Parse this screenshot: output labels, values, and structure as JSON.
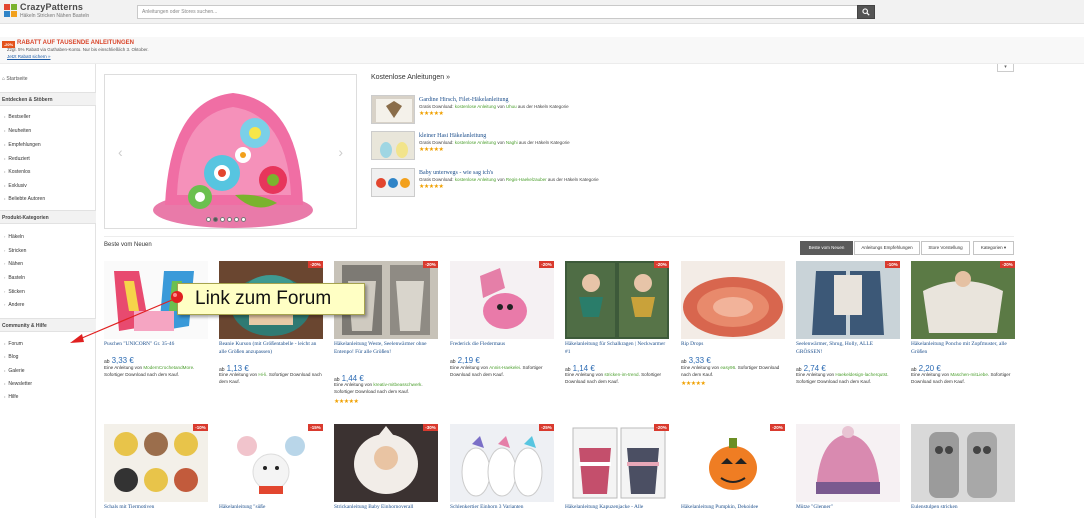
{
  "header": {
    "logo_name": "CrazyPatterns",
    "logo_tagline": "Häkeln Stricken Nähen Basteln",
    "search_placeholder": "Anleitungen oder Stores suchen...",
    "colors": {
      "red": "#e2462f",
      "green": "#7ab32e",
      "blue": "#2f84c7",
      "orange": "#f2a01c"
    }
  },
  "promo": {
    "badge": "-20%",
    "title": "RABATT AUF TAUSENDE ANLEITUNGEN",
    "subtitle": "Zzgl. 5% Rabatt via Guthaben-Konto. Nur bis einschließlich 3. Oktober.",
    "link": "Jetzt Rabatt sichern »"
  },
  "sidebar": {
    "home": "Startseite",
    "sections": [
      {
        "title": "Entdecken & Stöbern",
        "items": [
          "Bestseller",
          "Neuheiten",
          "Empfehlungen",
          "Reduziert",
          "Kostenlos",
          "Exklusiv",
          "Beliebte Autoren"
        ]
      },
      {
        "title": "Produkt-Kategorien",
        "items": [
          "Häkeln",
          "Stricken",
          "Nähen",
          "Basteln",
          "Sticken",
          "Andere"
        ]
      },
      {
        "title": "Community & Hilfe",
        "items": [
          "Forum",
          "Blog",
          "Galerie",
          "Newsletter",
          "Hilfe"
        ]
      }
    ]
  },
  "free": {
    "title": "Kostenlose Anleitungen »",
    "items": [
      {
        "name": "Gardine Hirsch, Filet-Häkelanleitung",
        "prefix": "Gratis Download:",
        "type": "kostenlose Anleitung",
        "by": "von",
        "author": "Uhuu",
        "suffix": "aus der Häkeln Kategorie",
        "stars": "★★★★★"
      },
      {
        "name": "kleiner Hasi Häkelanleitung",
        "prefix": "Gratis Download:",
        "type": "kostenlose Anleitung",
        "by": "von",
        "author": "Naghi",
        "suffix": "aus der Häkeln Kategorie",
        "stars": "★★★★★"
      },
      {
        "name": "Baby unterwegs - wie sag ich's",
        "prefix": "Gratis Download:",
        "type": "kostenlose Anleitung",
        "by": "von",
        "author": "Regis-Haekelzauber",
        "suffix": "aus der Häkeln Kategorie",
        "stars": "★★★★★"
      }
    ]
  },
  "best": {
    "title": "Beste vom Neuen",
    "tabs": [
      "Beste vom Neuen",
      "Anleitungs Empfehlungen",
      "Store Vorstellung",
      "Kategorien ▾"
    ],
    "row1": [
      {
        "title": "Puschen \"UNICORN\" Gr. 35-46",
        "price_prefix": "ab",
        "price": "3,33 €",
        "author_prefix": "Eine Anleitung von",
        "author": "ModernCrochetandMore",
        "meta": ". Sofortiger Download nach dem Kauf.",
        "stars": "",
        "badge": ""
      },
      {
        "title": "Beanie Kurson (mit Größentabelle - leicht an alle Größen anzupassen)",
        "price_prefix": "ab",
        "price": "1,13 €",
        "author_prefix": "Eine Anleitung von",
        "author": "Hi-li",
        "meta": ". Sofortiger Download nach dem Kauf.",
        "stars": "",
        "badge": "-20%"
      },
      {
        "title": "Häkelanleitung Weste, Seelenwärmer ohne Entenpo! Für alle Größen!",
        "price_prefix": "ab",
        "price": "1,44 €",
        "author_prefix": "Eine Anleitung von",
        "author": "kreativ-mitbeasschwerk",
        "meta": ". Sofortiger Download nach dem Kauf.",
        "stars": "★★★★★",
        "badge": "-20%"
      },
      {
        "title": "Frederick die Fledermaus",
        "price_prefix": "ab",
        "price": "2,19 €",
        "author_prefix": "Eine Anleitung von",
        "author": "Annis-Haekelei",
        "meta": ". Sofortiger Download nach dem Kauf.",
        "stars": "",
        "badge": "-20%"
      },
      {
        "title": "Häkelanleitung für Schalkragen | Neckwarmer #1",
        "price_prefix": "ab",
        "price": "1,14 €",
        "author_prefix": "Eine Anleitung von",
        "author": "stricken-im-trend",
        "meta": ". Sofortiger Download nach dem Kauf.",
        "stars": "",
        "badge": "-20%"
      },
      {
        "title": "Rip Drops",
        "price_prefix": "ab",
        "price": "3,33 €",
        "author_prefix": "Eine Anleitung von",
        "author": "easy96",
        "meta": ". Sofortiger Download nach dem Kauf.",
        "stars": "★★★★★",
        "badge": ""
      },
      {
        "title": "Seelenwärmer, Shrug, Holly, ALLE GRÖSSEN!",
        "price_prefix": "ab",
        "price": "2,74 €",
        "author_prefix": "Eine Anleitung von",
        "author": "Haekeldesign-lacherqutst",
        "meta": ". Sofortiger Download nach dem Kauf.",
        "stars": "",
        "badge": "-10%"
      },
      {
        "title": "Häkelanleitung Poncho mit Zopfmuster, alle Größen",
        "price_prefix": "ab",
        "price": "2,20 €",
        "author_prefix": "Eine Anleitung von",
        "author": "Maschen-mitLiebe",
        "meta": ". Sofortiger Download nach dem Kauf.",
        "stars": "",
        "badge": "-20%"
      }
    ],
    "row2": [
      {
        "title": "Schals mit Tiermotiven",
        "badge": "-10%"
      },
      {
        "title": "Häkelanleitung \"süße",
        "badge": "-15%"
      },
      {
        "title": "Strickanleitung Baby Einhornoverall",
        "badge": "-30%"
      },
      {
        "title": "Schlenkertier Einhorn 3 Varianten",
        "badge": "-25%"
      },
      {
        "title": "Häkelanleitung Kapuzenjacke - Alle",
        "badge": "-20%"
      },
      {
        "title": "Häkelanleitung Pumpkin, Dekoidee",
        "badge": "-20%"
      },
      {
        "title": "Mütze \"Glenner\"",
        "badge": ""
      },
      {
        "title": "Eulenstulpen stricken",
        "badge": ""
      }
    ]
  },
  "annotation": {
    "text": "Link zum Forum"
  }
}
